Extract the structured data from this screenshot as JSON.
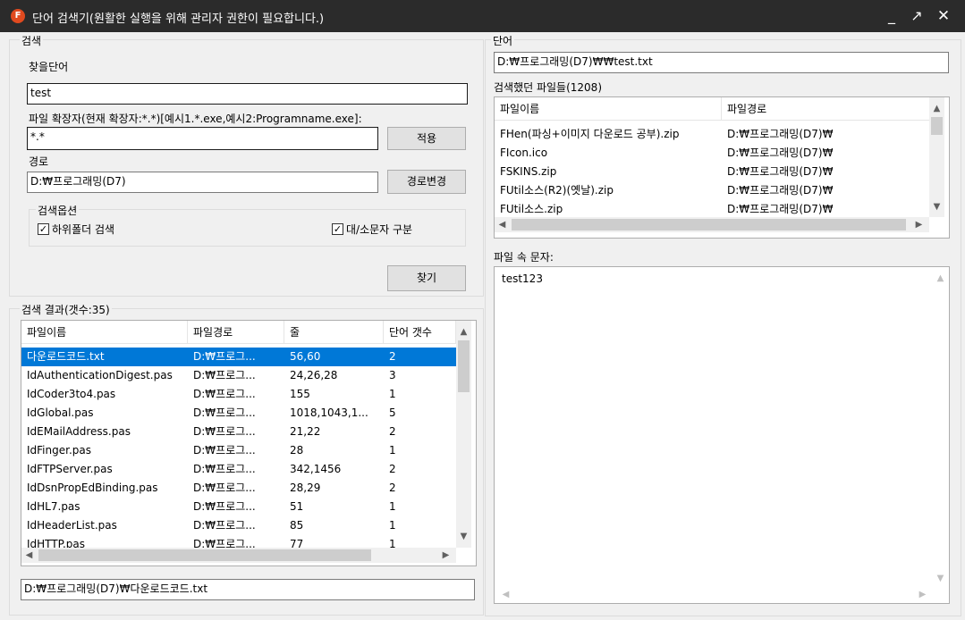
{
  "window": {
    "title": "단어 검색기(원활한 실행을 위해 관리자 권한이 필요합니다.)",
    "icon_glyph": "F",
    "minimize_glyph": "_",
    "maximize_glyph": "↗",
    "close_glyph": "✕"
  },
  "search": {
    "group_caption": "검색",
    "find_word_label": "찾을단어",
    "find_word_value": "test",
    "ext_label": "파일 확장자(현재 확장자:*.*)[예시1.*.exe,예시2:Programname.exe]:",
    "ext_value": "*.*",
    "apply_button": "적용",
    "path_label": "경로",
    "path_value": "D:₩프로그래밍(D7)",
    "change_path_button": "경로변경",
    "options_caption": "검색옵션",
    "subfolder_label": "하위폴더 검색",
    "subfolder_checked": true,
    "case_label": "대/소문자 구분",
    "case_checked": true,
    "find_button": "찾기"
  },
  "results": {
    "caption": "검색 결과(갯수:35)",
    "columns": [
      "파일이름",
      "파일경로",
      "줄",
      "단어 갯수"
    ],
    "rows": [
      {
        "name": "다운로드코드.txt",
        "path": "D:₩프로그...",
        "lines": "56,60",
        "count": "2",
        "selected": true
      },
      {
        "name": "IdAuthenticationDigest.pas",
        "path": "D:₩프로그...",
        "lines": "24,26,28",
        "count": "3"
      },
      {
        "name": "IdCoder3to4.pas",
        "path": "D:₩프로그...",
        "lines": "155",
        "count": "1"
      },
      {
        "name": "IdGlobal.pas",
        "path": "D:₩프로그...",
        "lines": "1018,1043,1...",
        "count": "5"
      },
      {
        "name": "IdEMailAddress.pas",
        "path": "D:₩프로그...",
        "lines": "21,22",
        "count": "2"
      },
      {
        "name": "IdFinger.pas",
        "path": "D:₩프로그...",
        "lines": "28",
        "count": "1"
      },
      {
        "name": "IdFTPServer.pas",
        "path": "D:₩프로그...",
        "lines": "342,1456",
        "count": "2"
      },
      {
        "name": "IdDsnPropEdBinding.pas",
        "path": "D:₩프로그...",
        "lines": "28,29",
        "count": "2"
      },
      {
        "name": "IdHL7.pas",
        "path": "D:₩프로그...",
        "lines": "51",
        "count": "1"
      },
      {
        "name": "IdHeaderList.pas",
        "path": "D:₩프로그...",
        "lines": "85",
        "count": "1"
      },
      {
        "name": "IdHTTP.pas",
        "path": "D:₩프로그...",
        "lines": "77",
        "count": "1"
      }
    ],
    "selected_path": "D:₩프로그래밍(D7)₩다운로드코드.txt"
  },
  "word": {
    "caption": "단어",
    "current_file": "D:₩프로그래밍(D7)₩₩test.txt",
    "searched_caption": "검색했던 파일들(1208)",
    "columns": [
      "파일이름",
      "파일경로"
    ],
    "files": [
      {
        "name": "FHen(파싱+이미지 다운로드 공부).zip",
        "path": "D:₩프로그래밍(D7)₩"
      },
      {
        "name": "FIcon.ico",
        "path": "D:₩프로그래밍(D7)₩"
      },
      {
        "name": "FSKINS.zip",
        "path": "D:₩프로그래밍(D7)₩"
      },
      {
        "name": "FUtil소스(R2)(옛날).zip",
        "path": "D:₩프로그래밍(D7)₩"
      },
      {
        "name": "FUtil소스.zip",
        "path": "D:₩프로그래밍(D7)₩"
      }
    ],
    "content_caption": "파일 속 문자:",
    "content_text": "test123"
  },
  "icons": {
    "up": "▲",
    "down": "▼",
    "left": "◀",
    "right": "▶",
    "check": "✓"
  }
}
